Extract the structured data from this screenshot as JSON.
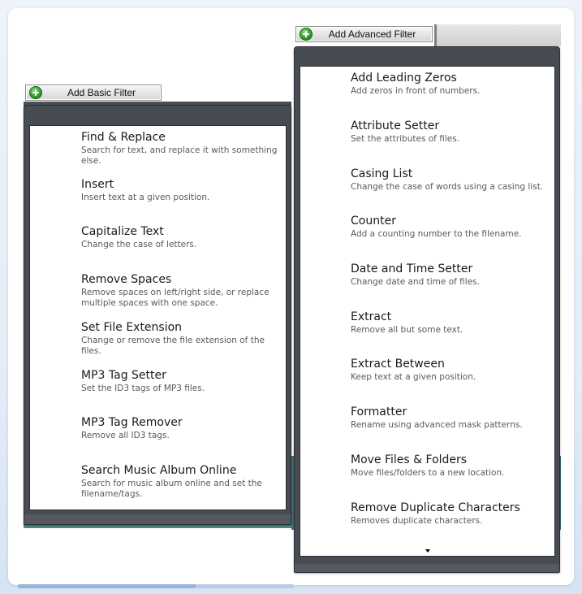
{
  "basic_filter": {
    "button_label": "Add Basic Filter",
    "button_icon": "plus-circle-icon",
    "items": [
      {
        "title": "Find & Replace",
        "desc": "Search for text, and replace it with something else."
      },
      {
        "title": "Insert",
        "desc": "Insert text at a given position."
      },
      {
        "title": "Capitalize Text",
        "desc": "Change the case of letters."
      },
      {
        "title": "Remove Spaces",
        "desc": "Remove spaces on left/right side, or replace multiple spaces with one space."
      },
      {
        "title": "Set File Extension",
        "desc": "Change or remove the file extension of the files."
      },
      {
        "title": "MP3 Tag Setter",
        "desc": "Set the ID3 tags of MP3 files."
      },
      {
        "title": "MP3 Tag Remover",
        "desc": "Remove all ID3 tags."
      },
      {
        "title": "Search Music Album Online",
        "desc": "Search for music album online and set the filename/tags."
      }
    ]
  },
  "advanced_filter": {
    "button_label": "Add Advanced Filter",
    "button_icon": "plus-circle-icon",
    "scroll_indicator": "chevron-down-icon",
    "items": [
      {
        "title": "Add Leading Zeros",
        "desc": "Add zeros in front of numbers."
      },
      {
        "title": "Attribute Setter",
        "desc": "Set the attributes of files."
      },
      {
        "title": "Casing List",
        "desc": "Change the case of words using a casing list."
      },
      {
        "title": "Counter",
        "desc": "Add a counting number to the filename."
      },
      {
        "title": "Date and Time Setter",
        "desc": "Change date and time of files."
      },
      {
        "title": "Extract",
        "desc": "Remove all but some text."
      },
      {
        "title": "Extract Between",
        "desc": "Keep text at a given position."
      },
      {
        "title": "Formatter",
        "desc": "Rename using advanced mask patterns."
      },
      {
        "title": "Move Files & Folders",
        "desc": "Move files/folders to a new location."
      },
      {
        "title": "Remove Duplicate Characters",
        "desc": "Removes duplicate characters."
      }
    ]
  },
  "colors": {
    "panel_frame": "#474b52",
    "panel_bottom": "#55595f",
    "teal_backdrop": "#41736f",
    "add_icon": "#2fa32a"
  }
}
